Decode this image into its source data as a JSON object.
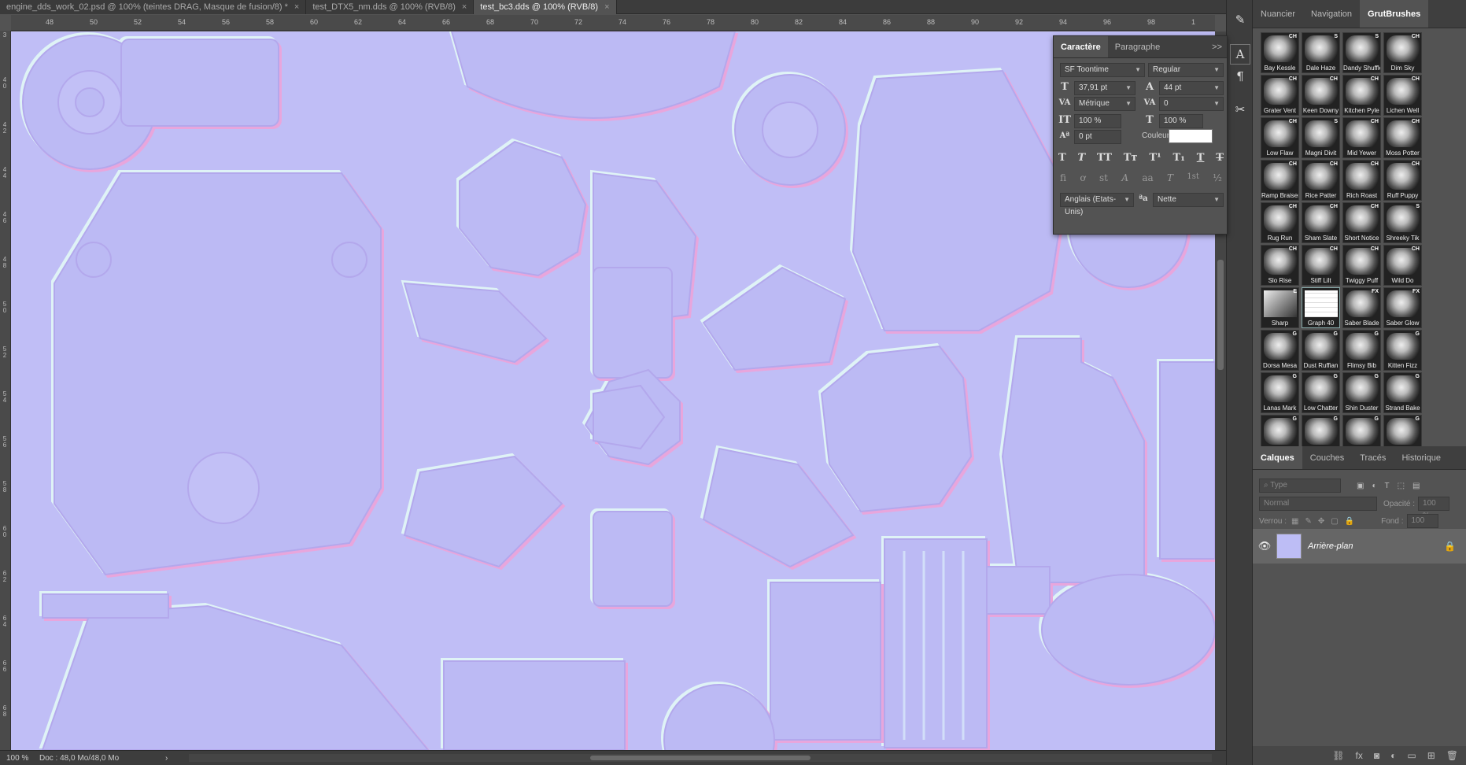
{
  "tabs": [
    {
      "label": "engine_dds_work_02.psd @ 100% (teintes DRAG, Masque de fusion/8) *",
      "close": "×",
      "active": false
    },
    {
      "label": "test_DTX5_nm.dds @ 100% (RVB/8)",
      "close": "×",
      "active": false
    },
    {
      "label": "test_bc3.dds @ 100% (RVB/8)",
      "close": "×",
      "active": true
    }
  ],
  "ruler_h": [
    "48",
    "50",
    "52",
    "54",
    "56",
    "58",
    "60",
    "62",
    "64",
    "66",
    "68",
    "70",
    "72",
    "74",
    "76",
    "78",
    "80",
    "82",
    "84",
    "86",
    "88",
    "90",
    "92",
    "94",
    "96",
    "98",
    "1"
  ],
  "ruler_v": [
    "3",
    "4\n0",
    "4\n2",
    "4\n4",
    "4\n6",
    "4\n8",
    "5\n0",
    "5\n2",
    "5\n4",
    "5\n6",
    "5\n8",
    "6\n0",
    "6\n2",
    "6\n4",
    "6\n6",
    "6\n8"
  ],
  "status": {
    "zoom": "100 %",
    "doc": "Doc : 48,0 Mo/48,0 Mo",
    "arrow": "›"
  },
  "colors": {
    "canvas_bg": "#c0bef6",
    "normal_light": "#e6f0ff",
    "normal_shadow": "#9a8fe6"
  },
  "panel_tabs": [
    "Nuancier",
    "Navigation",
    "GrutBrushes"
  ],
  "panel_tab_active": "GrutBrushes",
  "brushes": [
    {
      "name": "Bay Kessle",
      "badge": "CH"
    },
    {
      "name": "Dale Haze",
      "badge": "S"
    },
    {
      "name": "Dandy Shuffle",
      "badge": "S"
    },
    {
      "name": "Dim Sky",
      "badge": "CH"
    },
    {
      "name": "Grater Vent",
      "badge": "CH"
    },
    {
      "name": "Keen Downy",
      "badge": "CH"
    },
    {
      "name": "Kitchen Pyle",
      "badge": "CH"
    },
    {
      "name": "Lichen Well",
      "badge": "CH"
    },
    {
      "name": "Low Flaw",
      "badge": "CH"
    },
    {
      "name": "Magni Divit",
      "badge": "S"
    },
    {
      "name": "Mid Yewer",
      "badge": "CH"
    },
    {
      "name": "Moss Potter",
      "badge": "CH"
    },
    {
      "name": "Ramp Braiser",
      "badge": "CH"
    },
    {
      "name": "Rice Patter",
      "badge": "CH"
    },
    {
      "name": "Rich Roast",
      "badge": "CH"
    },
    {
      "name": "Ruff Puppy",
      "badge": "CH"
    },
    {
      "name": "Rug Run",
      "badge": "CH"
    },
    {
      "name": "Sham Slate",
      "badge": "CH"
    },
    {
      "name": "Short Notice",
      "badge": "CH"
    },
    {
      "name": "Shreeky Tik",
      "badge": "S"
    },
    {
      "name": "Slo Rise",
      "badge": "CH"
    },
    {
      "name": "Stiff Lilt",
      "badge": "CH"
    },
    {
      "name": "Twiggy Puff",
      "badge": "CH"
    },
    {
      "name": "Wild Do",
      "badge": "CH"
    },
    {
      "name": "Sharp",
      "badge": "E"
    },
    {
      "name": "Graph 40",
      "badge": ""
    },
    {
      "name": "Saber Blade",
      "badge": "FX"
    },
    {
      "name": "Saber Glow",
      "badge": "FX"
    },
    {
      "name": "Dorsa Mesa",
      "badge": "G"
    },
    {
      "name": "Dust Ruffian",
      "badge": "G"
    },
    {
      "name": "Flimsy Bib",
      "badge": "G"
    },
    {
      "name": "Kitten Fizz",
      "badge": "G"
    },
    {
      "name": "Lanas Mark",
      "badge": "G"
    },
    {
      "name": "Low Chatter",
      "badge": "G"
    },
    {
      "name": "Shin Duster",
      "badge": "G"
    },
    {
      "name": "Strand Bake",
      "badge": "G"
    },
    {
      "name": "",
      "badge": "G"
    },
    {
      "name": "",
      "badge": "G"
    },
    {
      "name": "",
      "badge": "G"
    },
    {
      "name": "",
      "badge": "G"
    }
  ],
  "character": {
    "tabs": [
      "Caractère",
      "Paragraphe"
    ],
    "font_family": "SF Toontime",
    "font_style": "Regular",
    "size": "37,91 pt",
    "leading": "44 pt",
    "kerning": "Métrique",
    "tracking": "0",
    "vscale": "100 %",
    "hscale": "100 %",
    "baseline": "0 pt",
    "color_label": "Couleur :",
    "language": "Anglais (Etats-Unis)",
    "antialias": "Nette",
    "aa_icon": "ªa",
    "styles": [
      "T",
      "T",
      "TT",
      "Tт",
      "T¹",
      "T₁",
      "T",
      "T"
    ],
    "opentype": [
      "ﬁ",
      "ơ",
      "st",
      "A",
      "aa",
      "T",
      "1st",
      "½"
    ],
    "menu": ">>"
  },
  "layers": {
    "tabs": [
      "Calques",
      "Couches",
      "Tracés",
      "Historique"
    ],
    "filter_label": "Type",
    "blend_mode": "Normal",
    "opacity_label": "Opacité :",
    "opacity": "100 %",
    "lock_label": "Verrou :",
    "fill_label": "Fond :",
    "fill": "100 %",
    "items": [
      {
        "name": "Arrière-plan"
      }
    ]
  },
  "bottom_icons": [
    "link-icon",
    "fx-icon",
    "mask-icon",
    "adjust-icon",
    "group-icon",
    "new-layer-icon",
    "trash-icon"
  ]
}
